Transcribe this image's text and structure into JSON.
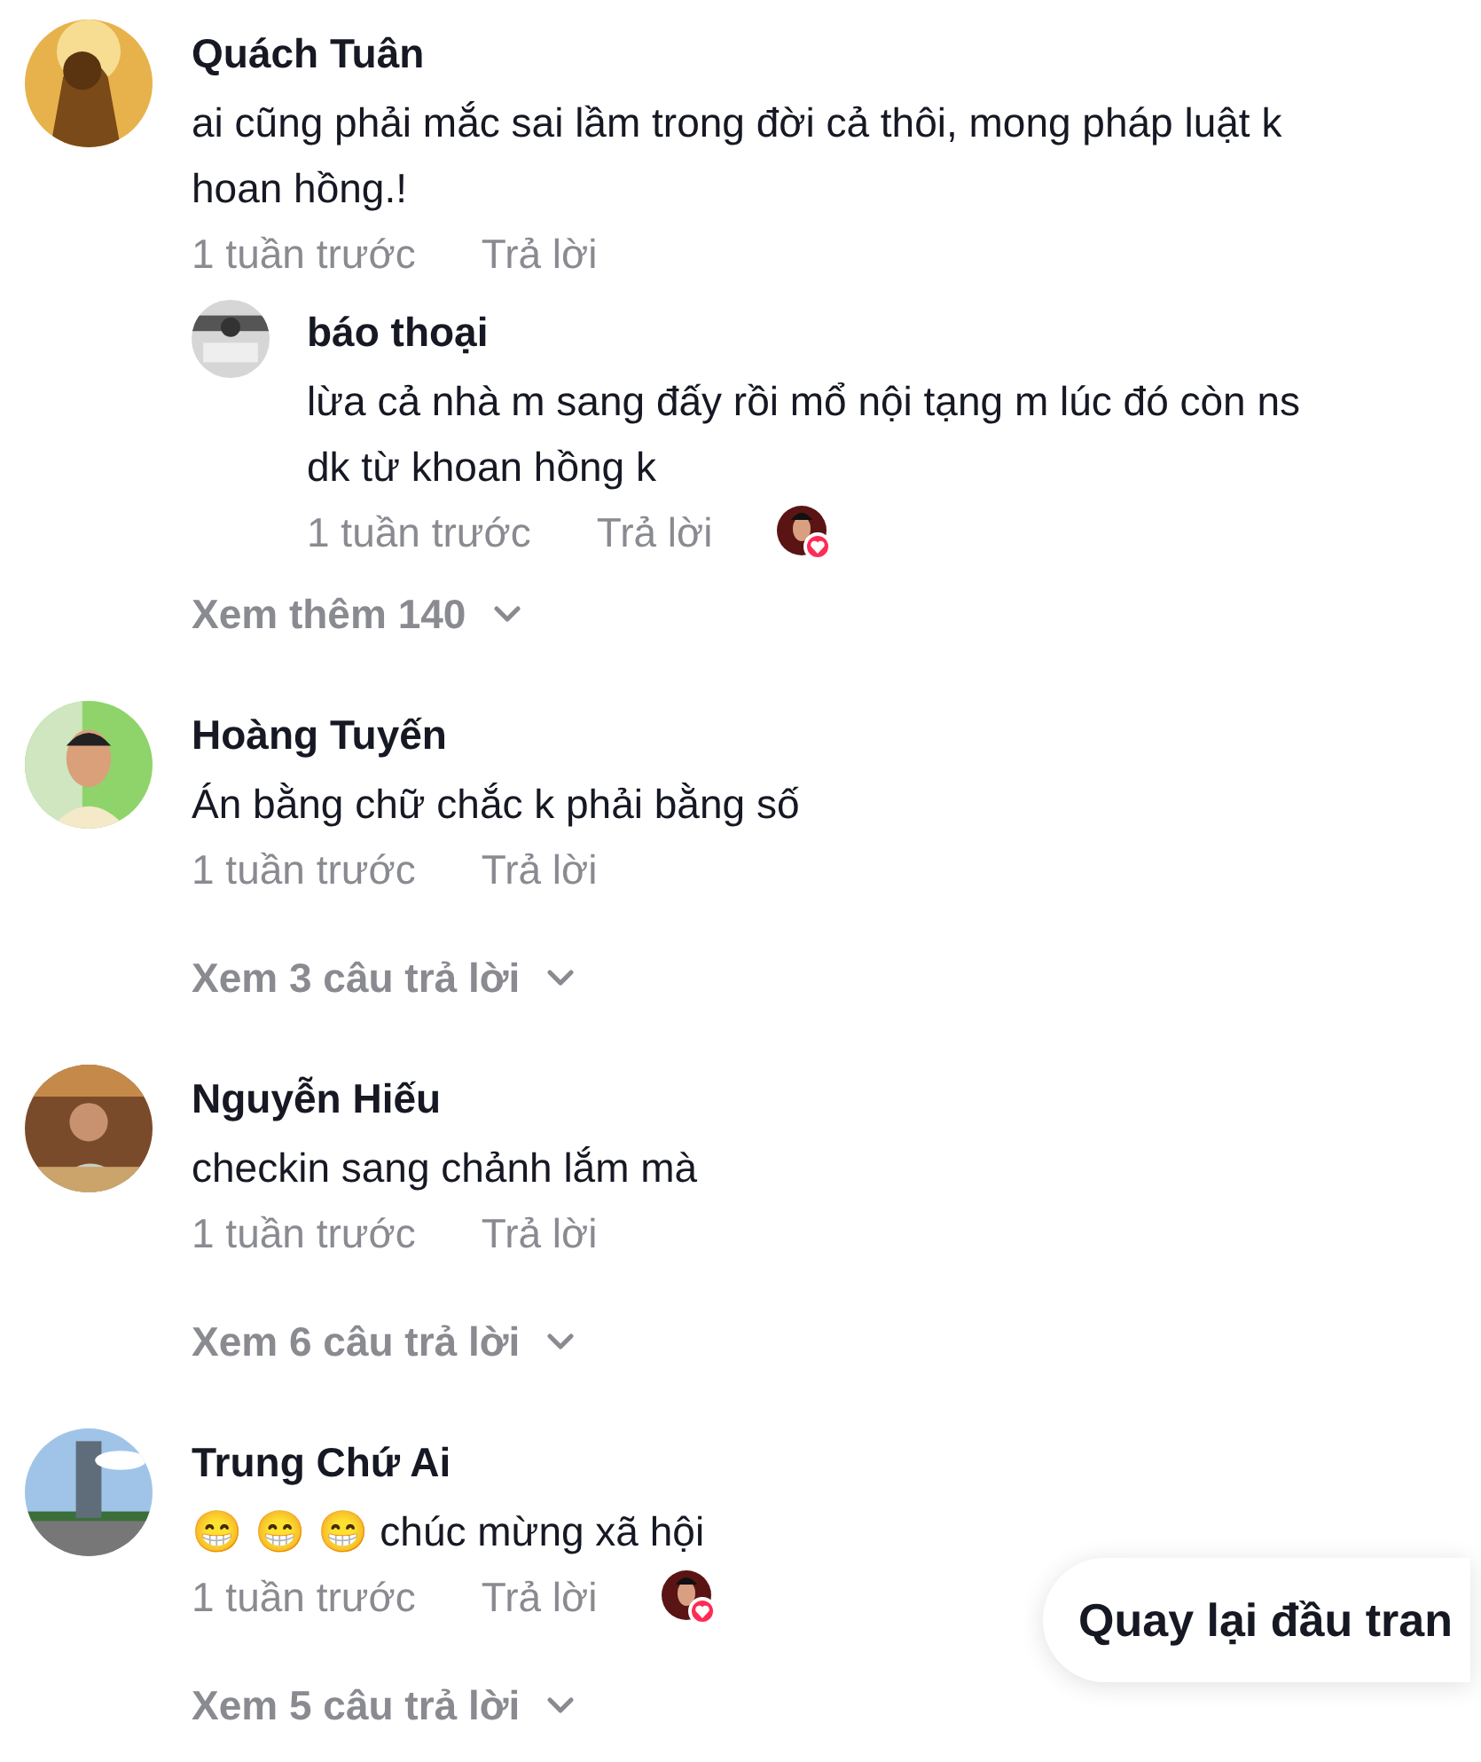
{
  "comments": [
    {
      "author": "Quách Tuân",
      "text": "ai cũng phải mắc sai lầm trong đời cả thôi, mong pháp luật k hoan hồng.!",
      "time": "1 tuần trước",
      "reply": "Trả lời",
      "liked_by_creator": false,
      "replies": [
        {
          "author": "báo thoại",
          "text": "lừa cả nhà m sang đấy rồi mổ nội tạng m lúc đó còn ns dk từ khoan hồng k",
          "time": "1 tuần trước",
          "reply": "Trả lời",
          "liked_by_creator": true
        }
      ],
      "view_more": "Xem thêm 140"
    },
    {
      "author": "Hoàng Tuyến",
      "text": "Án bằng chữ chắc k phải bằng số",
      "time": "1 tuần trước",
      "reply": "Trả lời",
      "liked_by_creator": false,
      "view_more": "Xem 3 câu trả lời"
    },
    {
      "author": "Nguyễn Hiếu",
      "text": "checkin sang chảnh lắm mà",
      "time": "1 tuần trước",
      "reply": "Trả lời",
      "liked_by_creator": false,
      "view_more": "Xem 6 câu trả lời"
    },
    {
      "author": "Trung Chứ Ai",
      "text": "😁 😁 😁 chúc mừng xã hội",
      "time": "1 tuần trước",
      "reply": "Trả lời",
      "liked_by_creator": true,
      "view_more": "Xem 5 câu trả lời"
    }
  ],
  "back_to_top": "Quay lại đầu tran"
}
